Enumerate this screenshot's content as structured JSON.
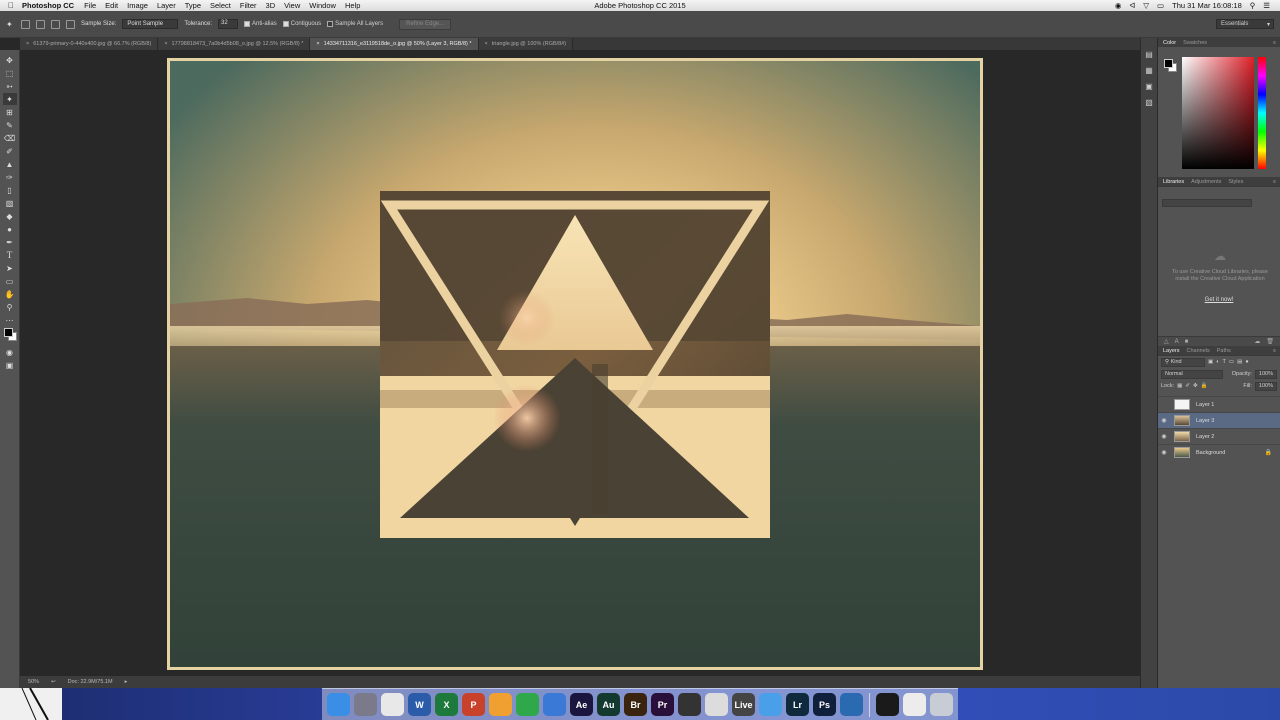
{
  "menubar": {
    "app_name": "Photoshop CC",
    "items": [
      "File",
      "Edit",
      "Image",
      "Layer",
      "Type",
      "Select",
      "Filter",
      "3D",
      "View",
      "Window",
      "Help"
    ],
    "window_title": "Adobe Photoshop CC 2015",
    "clock": "Thu 31 Mar  16:08:18"
  },
  "options": {
    "sample_size_label": "Sample Size:",
    "sample_size_value": "Point Sample",
    "tolerance_label": "Tolerance:",
    "tolerance_value": "32",
    "anti_alias": "Anti-alias",
    "contiguous": "Contiguous",
    "sample_all_layers": "Sample All Layers",
    "refine_edge": "Refine Edge...",
    "workspace": "Essentials"
  },
  "tabs": [
    {
      "label": "61379-primary-0-440x400.jpg @ 66.7% (RGB/8)"
    },
    {
      "label": "17798818473_7a0b4d5b08_o.jpg @ 12.5% (RGB/8) *"
    },
    {
      "label": "14334711316_e3119518de_o.jpg @ 50% (Layer 3, RGB/8) *"
    },
    {
      "label": "triangle.jpg @ 100% (RGB/8#)"
    }
  ],
  "status": {
    "zoom": "50%",
    "doc": "Doc: 22.9M/75.1M"
  },
  "panels": {
    "color_tabs": [
      "Color",
      "Swatches"
    ],
    "library_tabs": [
      "Libraries",
      "Adjustments",
      "Styles"
    ],
    "library_message": "To use Creative Cloud Libraries, please install the Creative Cloud Application",
    "library_link": "Get it now!",
    "layers_tabs": [
      "Layers",
      "Channels",
      "Paths"
    ],
    "kind_label": "Kind",
    "blend_mode": "Normal",
    "opacity_label": "Opacity:",
    "opacity_value": "100%",
    "lock_label": "Lock:",
    "fill_label": "Fill:",
    "fill_value": "100%"
  },
  "layers": [
    {
      "name": "Layer 1",
      "visible": false,
      "selected": false
    },
    {
      "name": "Layer 3",
      "visible": true,
      "selected": true
    },
    {
      "name": "Layer 2",
      "visible": true,
      "selected": false
    },
    {
      "name": "Background",
      "visible": true,
      "selected": false,
      "locked": true
    }
  ],
  "dock": [
    {
      "name": "finder-icon",
      "label": "",
      "color": "#3a8ee6"
    },
    {
      "name": "launchpad-icon",
      "label": "",
      "color": "#7a7a8a"
    },
    {
      "name": "chrome-icon",
      "label": "",
      "color": "#e8e8e8"
    },
    {
      "name": "word-icon",
      "label": "W",
      "color": "#2a5caa"
    },
    {
      "name": "excel-icon",
      "label": "X",
      "color": "#1e7a3c"
    },
    {
      "name": "powerpoint-icon",
      "label": "P",
      "color": "#c8412a"
    },
    {
      "name": "pages-icon",
      "label": "",
      "color": "#f0a030"
    },
    {
      "name": "numbers-icon",
      "label": "",
      "color": "#2ea84a"
    },
    {
      "name": "keynote-icon",
      "label": "",
      "color": "#3a7ad6"
    },
    {
      "name": "after-effects-icon",
      "label": "Ae",
      "color": "#1a1640"
    },
    {
      "name": "audition-icon",
      "label": "Au",
      "color": "#143a30"
    },
    {
      "name": "bridge-icon",
      "label": "Br",
      "color": "#3a2410"
    },
    {
      "name": "premiere-icon",
      "label": "Pr",
      "color": "#2a0f3a"
    },
    {
      "name": "final-cut-icon",
      "label": "",
      "color": "#333"
    },
    {
      "name": "disk-utility-icon",
      "label": "",
      "color": "#dcdcdc"
    },
    {
      "name": "live-icon",
      "label": "Live",
      "color": "#444"
    },
    {
      "name": "messenger-icon",
      "label": "",
      "color": "#4aa0e8"
    },
    {
      "name": "lightroom-icon",
      "label": "Lr",
      "color": "#0f2a3c"
    },
    {
      "name": "photoshop-icon",
      "label": "Ps",
      "color": "#0f1f3c"
    },
    {
      "name": "quicktime-icon",
      "label": "",
      "color": "#2a6ab0"
    },
    {
      "name": "terminal-icon",
      "label": "",
      "color": "#1a1a1a"
    },
    {
      "name": "keyboard-icon",
      "label": "",
      "color": "#ececec"
    },
    {
      "name": "trash-icon",
      "label": "",
      "color": "#c8ccd4"
    }
  ]
}
